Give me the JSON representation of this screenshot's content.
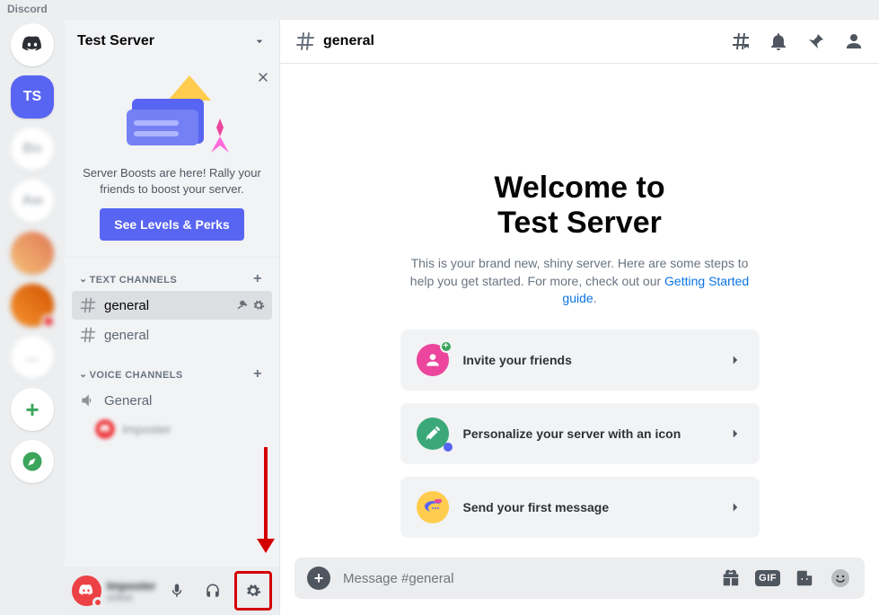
{
  "app_name": "Discord",
  "rail": {
    "active_server_initials": "TS",
    "add_label": "+",
    "blur_1": "Bo",
    "blur_2": "Aw",
    "blur_3": "..."
  },
  "server": {
    "name": "Test Server"
  },
  "boost": {
    "text": "Server Boosts are here! Rally your friends to boost your server.",
    "button": "See Levels & Perks"
  },
  "categories": {
    "text_header": "TEXT CHANNELS",
    "voice_header": "VOICE CHANNELS"
  },
  "text_channels": [
    {
      "name": "general",
      "selected": true
    },
    {
      "name": "general",
      "selected": false
    }
  ],
  "voice_channels": [
    {
      "name": "General"
    }
  ],
  "vc_user_name": "Imposter",
  "user_area": {
    "username": "Imposter",
    "tag": "online"
  },
  "channel_header": {
    "name": "general"
  },
  "welcome": {
    "line1": "Welcome to",
    "line2": "Test Server",
    "sub_pre": "This is your brand new, shiny server. Here are some steps to help you get started. For more, check out our ",
    "sub_link": "Getting Started guide",
    "sub_post": "."
  },
  "actions": [
    {
      "label": "Invite your friends"
    },
    {
      "label": "Personalize your server with an icon"
    },
    {
      "label": "Send your first message"
    }
  ],
  "composer": {
    "placeholder": "Message #general",
    "gif": "GIF"
  }
}
